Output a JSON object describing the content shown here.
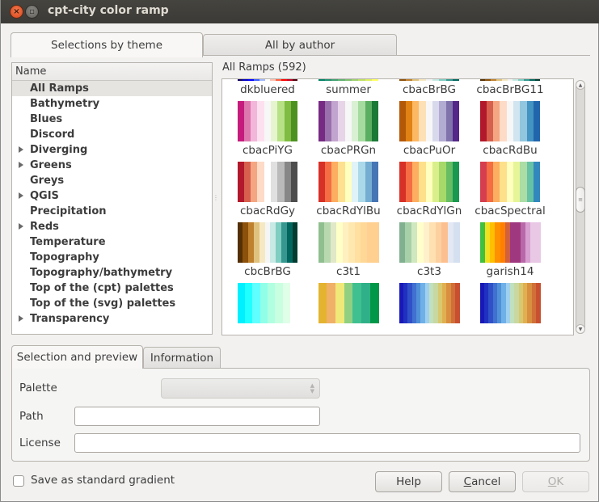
{
  "window": {
    "title": "cpt-city color ramp"
  },
  "top_tabs": [
    {
      "label": "Selections by theme",
      "active": true
    },
    {
      "label": "All by author",
      "active": false
    }
  ],
  "tree": {
    "header": "Name",
    "items": [
      {
        "label": "All Ramps",
        "expandable": false,
        "selected": true
      },
      {
        "label": "Bathymetry",
        "expandable": false
      },
      {
        "label": "Blues",
        "expandable": false
      },
      {
        "label": "Discord",
        "expandable": false
      },
      {
        "label": "Diverging",
        "expandable": true
      },
      {
        "label": "Greens",
        "expandable": true
      },
      {
        "label": "Greys",
        "expandable": false
      },
      {
        "label": "QGIS",
        "expandable": true
      },
      {
        "label": "Precipitation",
        "expandable": false
      },
      {
        "label": "Reds",
        "expandable": true
      },
      {
        "label": "Temperature",
        "expandable": false
      },
      {
        "label": "Topography",
        "expandable": false
      },
      {
        "label": "Topography/bathymetry",
        "expandable": false
      },
      {
        "label": "Top of the (cpt) palettes",
        "expandable": false
      },
      {
        "label": "Top of the (svg) palettes",
        "expandable": false
      },
      {
        "label": "Transparency",
        "expandable": true
      }
    ]
  },
  "ramps": {
    "label": "All Ramps (592)",
    "items": [
      {
        "name": "dkbluered",
        "colors": [
          "#10005a",
          "#0000c8",
          "#0000ff",
          "#4060ff",
          "#a0b8ff",
          "#ffffff",
          "#ffc0b0",
          "#ff6040",
          "#ff0000",
          "#c00020",
          "#500010"
        ]
      },
      {
        "name": "summer",
        "colors": [
          "#008066",
          "#209070",
          "#40a070",
          "#60b070",
          "#80c070",
          "#a0d070",
          "#c0e068",
          "#e0f060",
          "#ffff66"
        ]
      },
      {
        "name": "cbacBrBG",
        "colors": [
          "#8c510a",
          "#bf812d",
          "#dfc27d",
          "#f6e8c3",
          "#f5f5f5",
          "#c7eae5",
          "#80cdc1",
          "#35978f",
          "#01665e"
        ]
      },
      {
        "name": "cbacBrBG11",
        "colors": [
          "#543005",
          "#8c510a",
          "#bf812d",
          "#dfc27d",
          "#f6e8c3",
          "#f5f5f5",
          "#c7eae5",
          "#80cdc1",
          "#35978f",
          "#01665e",
          "#003c30"
        ]
      },
      {
        "name": "cbacPiYG",
        "colors": [
          "#c51b7d",
          "#de77ae",
          "#f1b6da",
          "#fde0ef",
          "#f7f7f7",
          "#e6f5d0",
          "#b8e186",
          "#7fbc41",
          "#4d9221"
        ]
      },
      {
        "name": "cbacPRGn",
        "colors": [
          "#762a83",
          "#9970ab",
          "#c2a5cf",
          "#e7d4e8",
          "#f7f7f7",
          "#d9f0d3",
          "#a6dba0",
          "#5aae61",
          "#1b7837"
        ]
      },
      {
        "name": "cbacPuOr",
        "colors": [
          "#b35806",
          "#e08214",
          "#fdb863",
          "#fee0b6",
          "#f7f7f7",
          "#d8daeb",
          "#b2abd2",
          "#8073ac",
          "#542788"
        ]
      },
      {
        "name": "cbacRdBu",
        "colors": [
          "#b2182b",
          "#d6604d",
          "#f4a582",
          "#fddbc7",
          "#f7f7f7",
          "#d1e5f0",
          "#92c5de",
          "#4393c3",
          "#2166ac"
        ]
      },
      {
        "name": "cbacRdGy",
        "colors": [
          "#b2182b",
          "#d6604d",
          "#f4a582",
          "#fddbc7",
          "#ffffff",
          "#e0e0e0",
          "#bababa",
          "#878787",
          "#4d4d4d"
        ]
      },
      {
        "name": "cbacRdYlBu",
        "colors": [
          "#d73027",
          "#f46d43",
          "#fdae61",
          "#fee090",
          "#ffffbf",
          "#e0f3f8",
          "#abd9e9",
          "#74add1",
          "#4575b4"
        ]
      },
      {
        "name": "cbacRdYlGn",
        "colors": [
          "#d73027",
          "#f46d43",
          "#fdae61",
          "#fee08b",
          "#ffffbf",
          "#d9ef8b",
          "#a6d96a",
          "#66bd63",
          "#1a9850"
        ]
      },
      {
        "name": "cbacSpectral",
        "colors": [
          "#d53e4f",
          "#f46d43",
          "#fdae61",
          "#fee08b",
          "#ffffbf",
          "#e6f598",
          "#abdda4",
          "#66c2a5",
          "#3288bd"
        ]
      },
      {
        "name": "cbcBrBG",
        "colors": [
          "#543005",
          "#8c510a",
          "#bf812d",
          "#dfc27d",
          "#f6e8c3",
          "#f5f5f5",
          "#c7eae5",
          "#80cdc1",
          "#35978f",
          "#01665e",
          "#003c30"
        ]
      },
      {
        "name": "c3t1",
        "colors": [
          "#8fbf8f",
          "#b8d8b0",
          "#e0e8c8",
          "#ffffc8",
          "#fff0c0",
          "#ffe8b0",
          "#ffe0a0",
          "#ffd898",
          "#ffd090",
          "#ffd090"
        ]
      },
      {
        "name": "c3t3",
        "colors": [
          "#80b090",
          "#a8d0a8",
          "#d0e8c0",
          "#ffffcc",
          "#fff0cc",
          "#ffe0b0",
          "#fcd0a0",
          "#fcc090",
          "#e4e8f4",
          "#d4e0f0"
        ]
      },
      {
        "name": "garish14",
        "colors": [
          "#40c040",
          "#f0e020",
          "#ffc000",
          "#ff9000",
          "#ff8000",
          "#d06040",
          "#a03880",
          "#a03880",
          "#b868a8",
          "#d8a0d0",
          "#e8c8e4",
          "#e8c8e4"
        ]
      },
      {
        "name": "",
        "colors": [
          "#00f0ff",
          "#20ffff",
          "#60ffff",
          "#90ffe8",
          "#b0ffe0",
          "#c8ffe0",
          "#e0ffe8",
          "#ffffff"
        ]
      },
      {
        "name": "",
        "colors": [
          "#e4b430",
          "#f0b068",
          "#f0e878",
          "#90d080",
          "#40c090",
          "#30b088",
          "#009848"
        ]
      },
      {
        "name": "",
        "colors": [
          "#1818b8",
          "#2030c0",
          "#3050c8",
          "#4070d0",
          "#5090d8",
          "#70b0e8",
          "#a0d0f0",
          "#c0e0c0",
          "#c8d8a0",
          "#d8c870",
          "#e0b050",
          "#d89040",
          "#d07038",
          "#c85030"
        ]
      },
      {
        "name": "",
        "colors": [
          "#1818b8",
          "#2030c0",
          "#3050c8",
          "#4070d0",
          "#5090d8",
          "#70b0e8",
          "#a0d0f0",
          "#c0e0c0",
          "#c8d8a0",
          "#d8c870",
          "#e0b050",
          "#d89040",
          "#d07038",
          "#c85030"
        ]
      }
    ]
  },
  "lower_tabs": [
    {
      "label": "Selection and preview",
      "active": true
    },
    {
      "label": "Information",
      "active": false
    }
  ],
  "form": {
    "palette_label": "Palette",
    "palette_value": "",
    "path_label": "Path",
    "path_value": "",
    "license_label": "License",
    "license_value": ""
  },
  "footer": {
    "checkbox_label": "Save as standard gradient",
    "checkbox_checked": false,
    "help_label": "Help",
    "cancel_label": "Cancel",
    "ok_label": "OK"
  }
}
